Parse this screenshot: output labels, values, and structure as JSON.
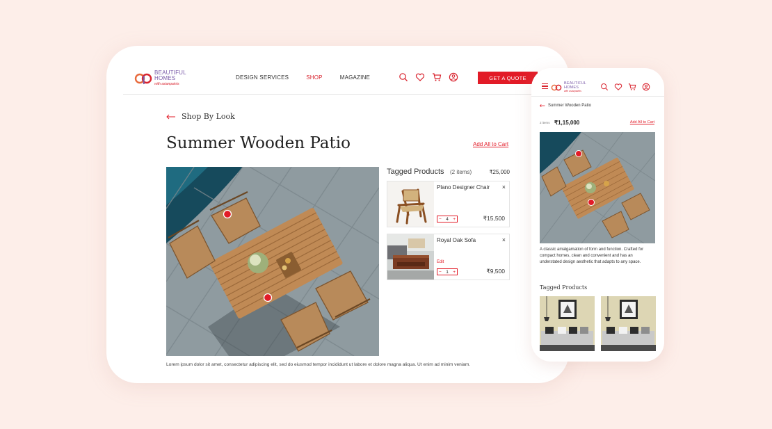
{
  "brand": {
    "line1": "BEAUTIFUL",
    "line2": "HOMES",
    "line3": "with asianpaints"
  },
  "nav": {
    "items": [
      "DESIGN SERVICES",
      "SHOP",
      "MAGAZINE"
    ],
    "active": "SHOP"
  },
  "header": {
    "cta_label": "GET A QUOTE"
  },
  "icons": [
    "search-icon",
    "heart-icon",
    "cart-icon",
    "user-icon",
    "back-arrow-icon",
    "close-icon",
    "menu-icon"
  ],
  "colors": {
    "accent": "#e21b27",
    "brand_purple": "#7a5aa8",
    "background": "#fdeee9"
  },
  "desktop": {
    "back_label": "Shop By Look",
    "title": "Summer Wooden Patio",
    "add_all_label": "Add All to Cart",
    "caption": "Lorem ipsum dolor sit amet, consectetur adipiscing elit, sed do eiusmod tempor incididunt ut labore et dolore magna aliqua. Ut enim ad minim veniam.",
    "tagged": {
      "title": "Tagged Products",
      "count": "(2 items)",
      "total": "₹25,000",
      "products": [
        {
          "name": "Plano Designer Chair",
          "qty": "4",
          "price": "₹15,500",
          "edit": ""
        },
        {
          "name": "Royal Oak Sofa",
          "qty": "1",
          "price": "₹9,500",
          "edit": "Edit"
        }
      ]
    },
    "stepper": {
      "minus": "−",
      "plus": "+"
    },
    "close_glyph": "×"
  },
  "mobile": {
    "back_label": "Summer Wooden Patio",
    "items_label": "2 items",
    "total": "₹1,15,000",
    "add_all_label": "Add All to Cart",
    "description": "A classic amalgamation of form and function. Crafted for compact homes, clean and convenient and has an understated design aesthetic that adapts to any space.",
    "tagged_title": "Tagged Products"
  }
}
